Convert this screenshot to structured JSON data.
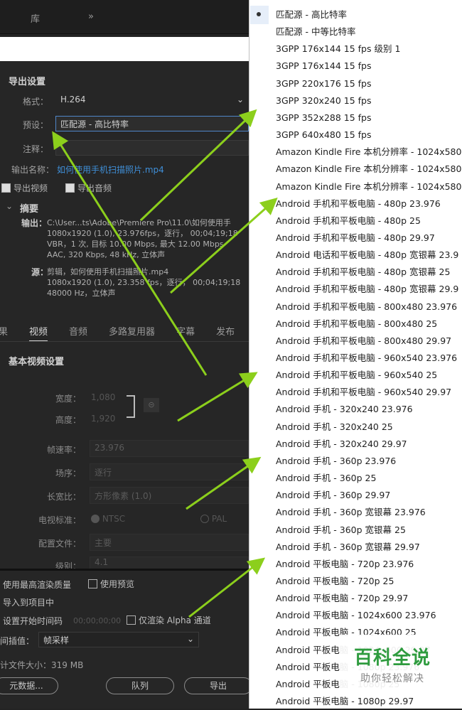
{
  "topbar": {
    "tab_library": "库",
    "expand_glyph": "»"
  },
  "export_settings": {
    "header": "导出设置",
    "format_label": "格式：",
    "format_value": "H.264",
    "preset_label": "预设：",
    "preset_value": "匹配源 - 高比特率",
    "comment_label": "注释：",
    "output_name_label": "输出名称：",
    "output_name_value": "如何使用手机扫描照片.mp4",
    "export_video": "导出视频",
    "export_audio": "导出音频",
    "summary_header": "摘要",
    "output_label": "输出：",
    "output_lines": [
      "C:\\User...ts\\Adobe\\Premiere Pro\\11.0\\如何使用手",
      "1080x1920 (1.0), 23.976fps，逐行， 00;04;19;18",
      "VBR，1 次, 目标 10.00 Mbps, 最大 12.00 Mbps",
      "AAC, 320 Kbps, 48 kHz, 立体声"
    ],
    "source_label": "源：",
    "source_lines": [
      "剪辑，如何使用手机扫描照片.mp4",
      "1080x1920 (1.0), 23.358 fps，逐行， 00;04;19;18",
      "48000 Hz，立体声"
    ]
  },
  "tabs": [
    "果",
    "视频",
    "音频",
    "多路复用器",
    "字幕",
    "发布"
  ],
  "video": {
    "header": "基本视频设置",
    "width_label": "宽度：",
    "width_value": "1,080",
    "height_label": "高度：",
    "height_value": "1,920",
    "frame_rate_label": "帧速率：",
    "frame_rate_value": "23.976",
    "field_order_label": "场序：",
    "field_order_value": "逐行",
    "aspect_label": "长宽比：",
    "aspect_value": "方形像素 (1.0)",
    "tv_standard_label": "电视标准：",
    "ntsc": "NTSC",
    "pal": "PAL",
    "profile_label": "配置文件：",
    "profile_value": "主要",
    "level_label": "级别：",
    "level_value": "4.1"
  },
  "bottom": {
    "max_render_quality": "使用最高渲染质量",
    "use_previews": "使用预览",
    "import_into_project": "导入到项目中",
    "set_start_timecode": "设置开始时间码",
    "timecode_value": "00;00;00;00",
    "render_alpha_only": "仅渲染 Alpha 通道",
    "interpolation_label": "间插值：",
    "interpolation_value": "帧采样",
    "file_size_label": "计文件大小：",
    "file_size_value": "319 MB",
    "metadata_button": "元数据...",
    "queue_button": "队列",
    "export_button": "导出"
  },
  "preset_dropdown": [
    "匹配源 - 高比特率",
    "匹配源 - 中等比特率",
    "3GPP 176x144 15 fps 级别 1",
    "3GPP 176x144 15 fps",
    "3GPP 220x176 15 fps",
    "3GPP 320x240 15 fps",
    "3GPP 352x288 15 fps",
    "3GPP 640x480 15 fps",
    "Amazon Kindle Fire 本机分辨率 - 1024x580",
    "Amazon Kindle Fire 本机分辨率 - 1024x580",
    "Amazon Kindle Fire 本机分辨率 - 1024x580",
    "Android 手机和平板电脑 - 480p 23.976",
    "Android 手机和平板电脑 - 480p 25",
    "Android 手机和平板电脑 - 480p 29.97",
    "Android 电话和平板电脑 - 480p 宽银幕 23.9",
    "Android 手机和平板电脑 - 480p 宽银幕 25",
    "Android 手机和平板电脑 - 480p 宽银幕 29.9",
    "Android 手机和平板电脑 - 800x480 23.976",
    "Android 手机和平板电脑 - 800x480 25",
    "Android 手机和平板电脑 - 800x480 29.97",
    "Android 手机和平板电脑 - 960x540 23.976",
    "Android 手机和平板电脑 - 960x540 25",
    "Android 手机和平板电脑 - 960x540 29.97",
    "Android 手机 - 320x240 23.976",
    "Android 手机 - 320x240 25",
    "Android 手机 - 320x240 29.97",
    "Android 手机 - 360p 23.976",
    "Android 手机 - 360p 25",
    "Android 手机 - 360p 29.97",
    "Android 手机 - 360p 宽银幕 23.976",
    "Android 手机 - 360p 宽银幕 25",
    "Android 手机 - 360p 宽银幕 29.97",
    "Android 平板电脑 - 720p 23.976",
    "Android 平板电脑 - 720p 25",
    "Android 平板电脑 - 720p 29.97",
    "Android 平板电脑 - 1024x600 23.976",
    "Android 平板电脑 - 1024x600 25",
    "Android 平板电脑 - 1024x600 29.97",
    "Android 平板电脑 - 1080p 23.976",
    "Android 平板电脑 - 1080p 25",
    "Android 平板电脑 - 1080p 29.97"
  ],
  "watermark": {
    "title": "百科全说",
    "subtitle": "助你轻松解决"
  },
  "colors": {
    "arrow": "#8ccf1c",
    "link": "#3f8fd8",
    "watermark_green": "#2e9b3e"
  }
}
